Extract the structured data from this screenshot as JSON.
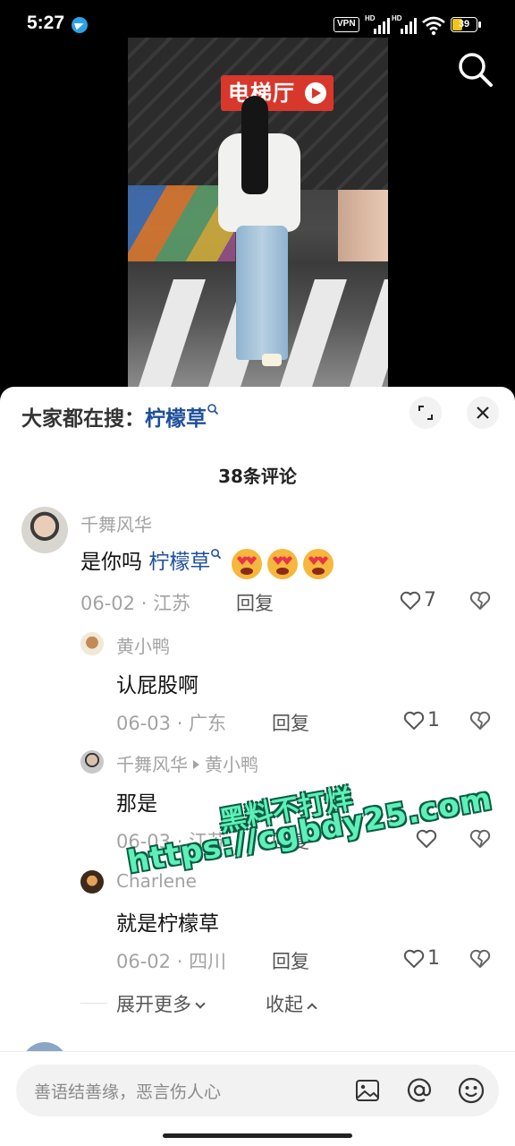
{
  "status_bar": {
    "time": "5:27",
    "vpn_label": "VPN",
    "network_label_1": "HD",
    "network_label_2": "HD",
    "battery_level": "39"
  },
  "video": {
    "sign_text": "电梯厅"
  },
  "sheet": {
    "suggest_prefix": "大家都在搜：",
    "suggest_keyword": "柠檬草",
    "comment_count": "38条评论"
  },
  "comments": [
    {
      "user": "千舞风华",
      "text": "是你吗",
      "keyword": "柠檬草",
      "date": "06-02",
      "location": "江苏",
      "reply_label": "回复",
      "likes": "7"
    },
    {
      "user": "黄小鸭",
      "text": "认屁股啊",
      "date": "06-03",
      "location": "广东",
      "reply_label": "回复",
      "likes": "1"
    },
    {
      "user": "千舞风华",
      "reply_to": "黄小鸭",
      "text": "那是",
      "date": "06-03",
      "location": "江苏",
      "reply_label": "回复",
      "likes": ""
    },
    {
      "user": "Charlene",
      "text": "就是柠檬草",
      "date": "06-02",
      "location": "四川",
      "reply_label": "回复",
      "likes": "1"
    }
  ],
  "thread_controls": {
    "expand_more": "展开更多",
    "collapse": "收起"
  },
  "watermark": {
    "line1": "黑料不打烊",
    "line2": "https://cgbdy25.com"
  },
  "input": {
    "placeholder": "善语结善缘，恶言伤人心"
  },
  "icons": {
    "image": "image-icon",
    "mention": "at-icon",
    "emoji": "emoji-icon"
  }
}
